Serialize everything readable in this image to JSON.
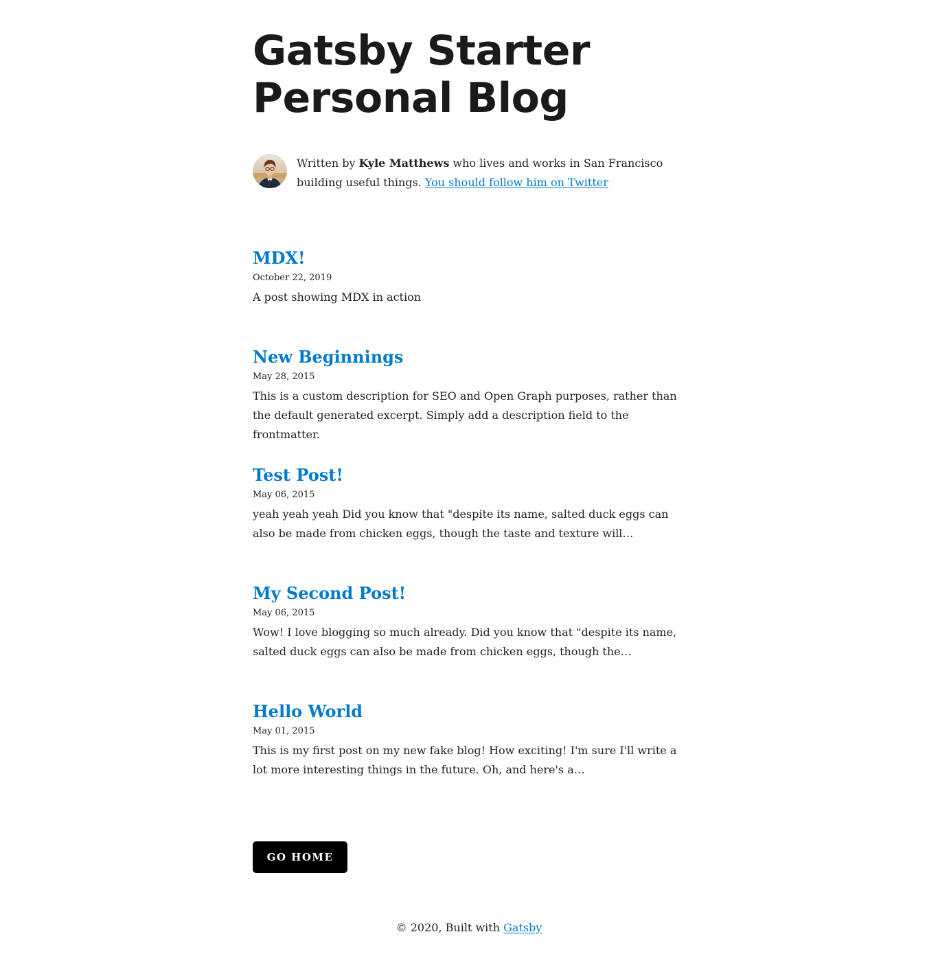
{
  "site": {
    "title": "Gatsby Starter Personal Blog"
  },
  "bio": {
    "prefix": "Written by ",
    "author": "Kyle Matthews",
    "middle": " who lives and works in San Francisco building useful things. ",
    "twitter_link": "You should follow him on Twitter"
  },
  "posts": [
    {
      "title": "MDX!",
      "date": "October 22, 2019",
      "description": "A post showing MDX in action"
    },
    {
      "title": "New Beginnings",
      "date": "May 28, 2015",
      "description": "This is a custom description for SEO and Open Graph purposes, rather than the default generated excerpt. Simply add a description field to the frontmatter."
    },
    {
      "title": "Test Post!",
      "date": "May 06, 2015",
      "description": "yeah yeah yeah Did you know that \"despite its name, salted duck eggs can also be made from chicken eggs, though the taste and texture will…"
    },
    {
      "title": "My Second Post!",
      "date": "May 06, 2015",
      "description": "Wow! I love blogging so much already. Did you know that \"despite its name, salted duck eggs can also be made from chicken eggs, though the…"
    },
    {
      "title": "Hello World",
      "date": "May 01, 2015",
      "description": "This is my first post on my new fake blog! How exciting! I'm sure I'll write a lot more interesting things in the future. Oh, and here's a…"
    }
  ],
  "actions": {
    "go_home_label": "GO HOME"
  },
  "footer": {
    "copyright": "© 2020, Built with ",
    "link": "Gatsby"
  },
  "colors": {
    "link": "#007acc",
    "text": "#222222",
    "button_bg": "#000000"
  }
}
